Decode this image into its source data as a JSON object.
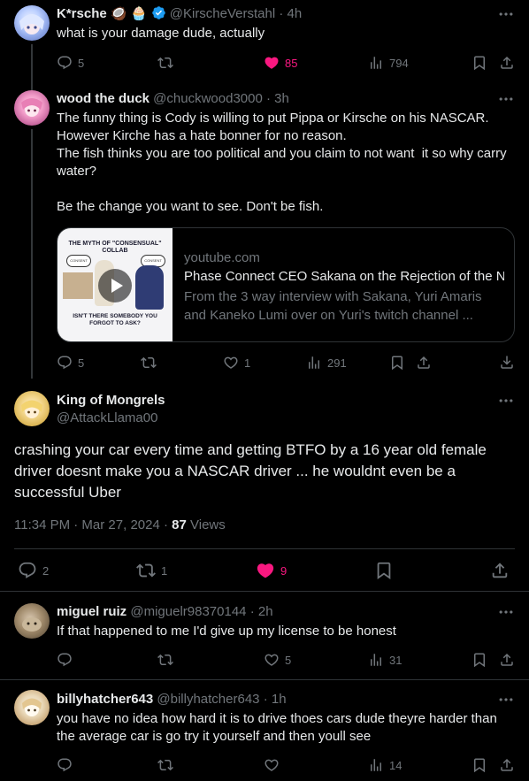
{
  "tweets": [
    {
      "name": "K*rsche",
      "emojis": "🥥 🧁",
      "handle": "@KirscheVerstahl",
      "time": "· 4h",
      "text": "what is your damage dude, actually",
      "replies": "5",
      "retweets": "",
      "likes": "85",
      "views": "794"
    },
    {
      "name": "wood the duck",
      "handle": "@chuckwood3000",
      "time": "· 3h",
      "text": "The funny thing is Cody is willing to put Pippa or Kirsche on his NASCAR. However Kirche has a hate bonner for no reason.\nThe fish thinks you are too political and you claim to not want  it so why carry water?\n\nBe the change you want to see. Don't be fish.",
      "replies": "5",
      "retweets": "",
      "likes": "1",
      "views": "291",
      "card": {
        "domain": "youtube.com",
        "title": "Phase Connect CEO Sakana on the Rejection of the N",
        "description": "From the 3 way interview with Sakana, Yuri Amaris and Kaneko Lumi over on Yuri's twitch channel ...",
        "thumb_top": "THE MYTH OF \"CONSENSUAL\" COLLAB",
        "thumb_bottom": "ISN'T THERE SOMEBODY YOU FORGOT TO ASK?",
        "thumb_bubble_left": "CONSENT",
        "thumb_bubble_right": "CONSENT"
      }
    },
    {
      "name": "King of Mongrels",
      "handle": "@AttackLlama00",
      "text": "crashing your car every time and getting BTFO by a 16 year old female driver doesnt make you a NASCAR driver ... he wouldnt even be a successful Uber",
      "timestamp": "11:34 PM · Mar 27, 2024 ·",
      "views_count": "87",
      "views_label": "Views",
      "replies": "2",
      "retweets": "1",
      "likes": "9"
    },
    {
      "name": "miguel ruiz",
      "handle": "@miguelr98370144",
      "time": "· 2h",
      "text": "If that happened to me I'd give up my license to be honest",
      "replies": "",
      "retweets": "",
      "likes": "5",
      "views": "31"
    },
    {
      "name": "billyhatcher643",
      "handle": "@billyhatcher643",
      "time": "· 1h",
      "text": "you have no idea how hard it is to drive thoes cars dude theyre harder than the average car is go try it yourself and then youll see",
      "replies": "",
      "retweets": "",
      "likes": "",
      "views": "14"
    }
  ],
  "colors": {
    "like": "#f91880",
    "muted": "#71767b",
    "verified": "#1d9bf0",
    "divider": "#2f3336"
  }
}
